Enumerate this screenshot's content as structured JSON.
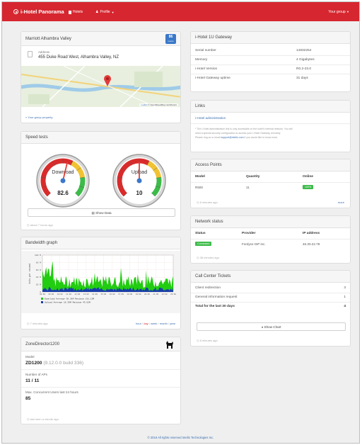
{
  "nav": {
    "brand": "i-Hotel Panorama",
    "hotels": "Hotels",
    "profile": "Profile",
    "group": "Your group"
  },
  "location": {
    "title": "Marriott Alhambra Valley",
    "badge_top": "86",
    "badge_bottom": "rooms",
    "address_label": "Address",
    "address": "455 Duke Road West, Alhambra Valley, NZ",
    "map_credit_leaflet": "Leaflet",
    "map_credit_osm": "© OpenStreetMap contributors",
    "group_link": "« Your group property"
  },
  "speed": {
    "title": "Speed tests",
    "download_label": "Download",
    "download_value": "82.6",
    "download_fraction": 0.55,
    "upload_label": "Upload",
    "upload_value": "10",
    "upload_fraction": 0.5,
    "show_data": "Show Data",
    "updated": "about 7 hours ago"
  },
  "bandwidth": {
    "title": "Bandwidth graph",
    "y_label": "bits per second",
    "y_ticks": [
      "100 M",
      "80 M",
      "60 M",
      "40 M",
      "20 M",
      "0"
    ],
    "x_ticks": [
      "08:00",
      "09:00",
      "10:00",
      "11:00",
      "12:00",
      "13:00",
      "14:00",
      "15:00",
      "16:00",
      "17:00",
      "18:00",
      "19:00",
      "20:00",
      "21:00",
      "22:00",
      "23:00"
    ],
    "legend_download": "Download  Average  38.3kM  Maximum  131.13M",
    "legend_upload": "Upload    Average  16.39M  Maximum  43.62M",
    "updated": "7 minutes ago",
    "range_links": [
      "hour",
      "day",
      "week",
      "month",
      "year"
    ],
    "colors": {
      "download": "#22cc11",
      "upload": "#1a3ea8"
    }
  },
  "zd": {
    "title": "ZoneDirector1200",
    "model_label": "Model",
    "model_value": "ZD1200",
    "model_build": "(9.12.0.0 build 336)",
    "aps_label": "Number of APs",
    "aps_value": "11 / 11",
    "users_label": "Max. Concurrent Users last 24 hours",
    "users_value": "85",
    "updated": "last seen a minute ago"
  },
  "gateway": {
    "title": "i-Hotel 1U Gateway",
    "rows": [
      {
        "label": "Serial number",
        "value": "14832254"
      },
      {
        "label": "Memory",
        "value": "4 Gigabytes"
      },
      {
        "label": "i-Hotel Version",
        "value": "R0.2-23.0"
      },
      {
        "label": "i-Hotel Gateway uptime",
        "value": "31 days"
      }
    ]
  },
  "links": {
    "title": "Links",
    "admin_link": "i-Hotel administration",
    "note_1": "* The i-Hotel administration link is only accessible on the hotel's internal network. You will",
    "note_2": "need a special security configuration to access your i-Hotel Gateway remotely.",
    "note_3_pre": "Please ring us or email",
    "note_3_email": "support@intello.com",
    "note_3_post": "if you would like to know more."
  },
  "ap": {
    "title": "Access Points",
    "headers": [
      "Model",
      "Quantity",
      "Online"
    ],
    "rows": [
      {
        "model": "R500",
        "quantity": "11",
        "online": "100%"
      }
    ],
    "updated": "8 minutes ago",
    "more": "more"
  },
  "network": {
    "title": "Network status",
    "headers": [
      "Status",
      "Provider",
      "IP address"
    ],
    "rows": [
      {
        "status": "Connected",
        "provider": "Fordyce ISP inc.",
        "ip": "46.30.22.78"
      }
    ],
    "updated": "38 minutes ago"
  },
  "tickets": {
    "title": "Call Center Tickets",
    "rows": [
      {
        "label": "Client redirection",
        "value": "3"
      },
      {
        "label": "General information request",
        "value": "1"
      }
    ],
    "total_label": "Total for the last 30 days",
    "total_value": "4",
    "show_chart": "Show Chart",
    "updated": "8 minutes ago"
  },
  "footer": "© 2016 All rights reserved Intello Technologies Inc.",
  "colors": {
    "brand": "#d6262f",
    "success": "#3dbb4a",
    "link": "#3a6fb0"
  }
}
